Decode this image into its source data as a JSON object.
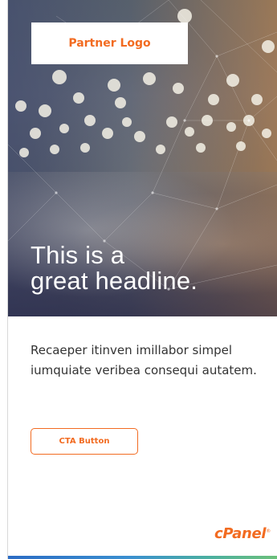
{
  "hero": {
    "logo_text": "Partner Logo",
    "headline_line1": "This is a",
    "headline_line2": "great headline."
  },
  "content": {
    "body": "Recaeper itinven imillabor simpel iumquiate veribea consequi autatem.",
    "cta_label": "CTA Button"
  },
  "footer": {
    "brand": "cPanel",
    "brand_mark": "®"
  },
  "colors": {
    "accent": "#f26b21",
    "text": "#333333",
    "bar_start": "#2b6cc4",
    "bar_end": "#6cc07a"
  }
}
